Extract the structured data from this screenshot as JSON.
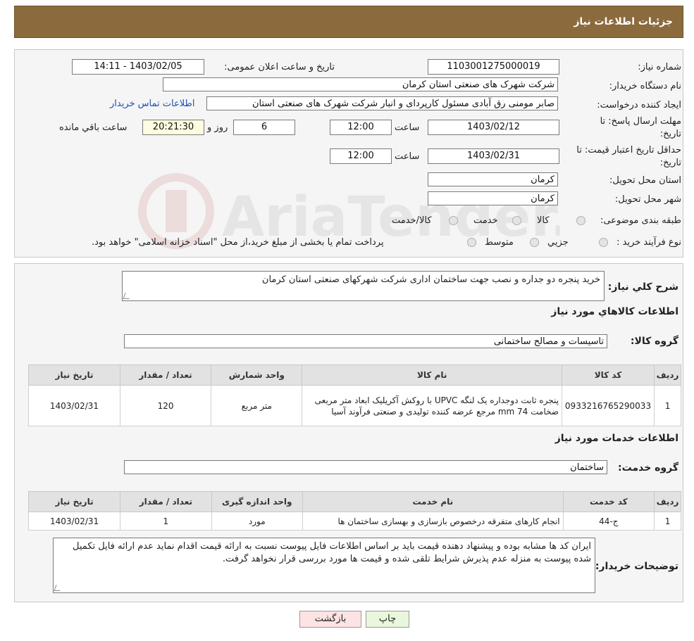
{
  "header": {
    "title": "جزئیات اطلاعات نیاز"
  },
  "form": {
    "need_number_label": "شماره نیاز:",
    "need_number": "1103001275000019",
    "announce_label": "تاریخ و ساعت اعلان عمومی:",
    "announce_value": "1403/02/05 - 14:11",
    "buyer_label": "نام دستگاه خریدار:",
    "buyer_value": "شرکت شهرک های صنعتی استان کرمان",
    "creator_label": "ایجاد کننده درخواست:",
    "creator_value": "صابر مومنی رق آبادی مسئول کارپردای و انبار شرکت شهرک های صنعتی استان",
    "contact_link": "اطلاعات تماس خریدار",
    "deadline_label_1": "مهلت ارسال پاسخ: تا",
    "deadline_label_2": "تاریخ:",
    "deadline_date": "1403/02/12",
    "time_label": "ساعت",
    "deadline_time": "12:00",
    "days_value": "6",
    "days_label": "روز و",
    "remaining_value": "20:21:30",
    "remaining_label": "ساعت باقي مانده",
    "validity_label_1": "حداقل تاریخ اعتبار قیمت: تا",
    "validity_label_2": "تاریخ:",
    "validity_date": "1403/02/31",
    "validity_time": "12:00",
    "province_label": "استان محل تحویل:",
    "province_value": "کرمان",
    "city_label": "شهر محل تحویل:",
    "city_value": "کرمان",
    "category_label": "طبقه بندی موضوعی:",
    "category_options": [
      "کالا",
      "خدمت",
      "کالا/خدمت"
    ],
    "process_label": "نوع فرآیند خرید :",
    "process_options": [
      "جزیي",
      "متوسط"
    ],
    "process_note": "پرداخت تمام یا بخشی از مبلغ خرید،از محل \"اسناد خزانه اسلامی\" خواهد بود."
  },
  "summary": {
    "label": "شرح كلي نياز:",
    "value": "خرید پنجره دو جداره و نصب جهت ساختمان اداری شرکت شهرکهای صنعتی استان کرمان"
  },
  "goods": {
    "section_title": "اطلاعات كالاهاي مورد نياز",
    "group_label": "گروه کالا:",
    "group_value": "تاسیسات و مصالح ساختمانی",
    "columns": [
      "ردیف",
      "کد کالا",
      "نام کالا",
      "واحد شمارش",
      "تعداد / مقدار",
      "تاریخ نیاز"
    ],
    "rows": [
      {
        "row": "1",
        "code": "0933216765290033",
        "name": "پنجره ثابت دوجداره یک لنگه UPVC با روکش آکریلیک ابعاد متر مربعی ضخامت mm 74 مرجع عرضه کننده تولیدی و صنعتی فرآوند آسیا",
        "unit": "متر مربع",
        "qty": "120",
        "date": "1403/02/31"
      }
    ]
  },
  "services": {
    "section_title": "اطلاعات خدمات مورد نياز",
    "group_label": "گروه خدمت:",
    "group_value": "ساختمان",
    "columns": [
      "ردیف",
      "کد خدمت",
      "نام خدمت",
      "واحد اندازه گیری",
      "تعداد / مقدار",
      "تاریخ نیاز"
    ],
    "rows": [
      {
        "row": "1",
        "code": "ج-44",
        "name": "انجام کارهای متفرقه درخصوص بازسازی و بهسازی ساختمان ها",
        "unit": "مورد",
        "qty": "1",
        "date": "1403/02/31"
      }
    ]
  },
  "buyer_notes": {
    "label": "توضیحات خریدار:",
    "value": "ایران کد ها مشابه بوده و پیشنهاد دهنده قیمت باید بر اساس اطلاعات فایل پیوست نسبت به ارائه قیمت اقدام نماید عدم ارائه فایل تکمیل شده پیوست به منزله عدم پذیرش شرایط تلقی شده و قیمت ها مورد بررسی قرار نخواهد گرفت."
  },
  "buttons": {
    "print": "چاپ",
    "back": "بازگشت"
  },
  "watermark": {
    "text": "AriaTender.neT"
  },
  "colors": {
    "header_bg": "#8b6b3d",
    "link": "#1a4fb8",
    "back_btn": "#fde3e3",
    "print_btn": "#e9f7dc"
  }
}
